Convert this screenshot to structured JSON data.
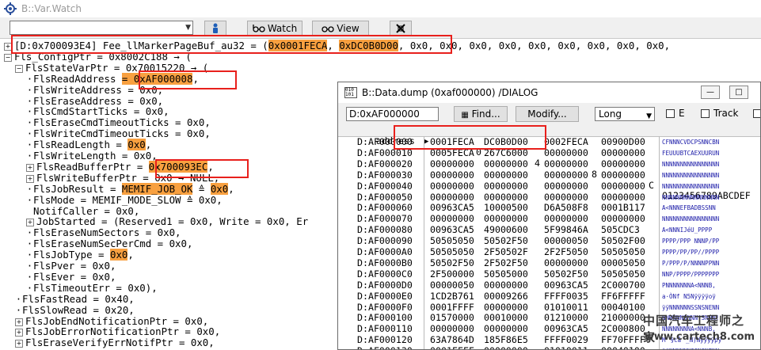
{
  "window": {
    "title": "B::Var.Watch"
  },
  "toolbar": {
    "watch_label": "Watch",
    "view_label": "View"
  },
  "tree": [
    {
      "level": 0,
      "expander": "plus",
      "marker": "none",
      "text": "[D:0x700093E4] Fee_llMarkerPageBuf_au32 = (",
      "hl": "0x0001FECA",
      "sep": ", ",
      "hl2": "0xDC0B0D00",
      "tail": ", 0x0, 0x0, 0x0, 0x0, 0x0, 0x0, 0x0, 0x0, 0x0,"
    },
    {
      "level": 0,
      "expander": "minus",
      "marker": "none",
      "text": "Fls_ConfigPtr = 0x8002C188 → ("
    },
    {
      "level": 1,
      "expander": "minus",
      "marker": "none",
      "text": "FlsStateVarPtr = 0x70015220 → ("
    },
    {
      "level": 2,
      "expander": "none",
      "marker": "dot",
      "text": "FlsReadAddress ",
      "hl": "= 0xAF000008",
      "tail": ","
    },
    {
      "level": 2,
      "expander": "none",
      "marker": "dot",
      "text": "FlsWriteAddress = 0x0,"
    },
    {
      "level": 2,
      "expander": "none",
      "marker": "dot",
      "text": "FlsEraseAddress = 0x0,"
    },
    {
      "level": 2,
      "expander": "none",
      "marker": "dot",
      "text": "FlsCmdStartTicks = 0x0,"
    },
    {
      "level": 2,
      "expander": "none",
      "marker": "dot",
      "text": "FlsEraseCmdTimeoutTicks = 0x0,"
    },
    {
      "level": 2,
      "expander": "none",
      "marker": "dot",
      "text": "FlsWriteCmdTimeoutTicks = 0x0,"
    },
    {
      "level": 2,
      "expander": "none",
      "marker": "dot",
      "text": "FlsReadLength = ",
      "hl": "0x0",
      "tail": ","
    },
    {
      "level": 2,
      "expander": "none",
      "marker": "dot",
      "text": "FlsWriteLength = 0x0,"
    },
    {
      "level": 2,
      "expander": "plus",
      "marker": "none",
      "text": "FlsReadBufferPtr = ",
      "hl": "0x700093EC",
      "tail": ","
    },
    {
      "level": 2,
      "expander": "plus",
      "marker": "none",
      "text": "FlsWriteBufferPtr = 0x0 → NULL,"
    },
    {
      "level": 2,
      "expander": "none",
      "marker": "dot",
      "text": "FlsJobResult = ",
      "hl": "MEMIF_JOB_OK",
      "sep": " ≙ ",
      "hl2": "0x0",
      "tail": ","
    },
    {
      "level": 2,
      "expander": "none",
      "marker": "dot",
      "text": "FlsMode = MEMIF_MODE_SLOW ≙ 0x0,"
    },
    {
      "level": 2,
      "expander": "none",
      "marker": "none",
      "text": "NotifCaller = 0x0,"
    },
    {
      "level": 2,
      "expander": "plus",
      "marker": "none",
      "text": "JobStarted = (Reserved1 = 0x0, Write = 0x0, Er"
    },
    {
      "level": 2,
      "expander": "none",
      "marker": "dot",
      "text": "FlsEraseNumSectors = 0x0,"
    },
    {
      "level": 2,
      "expander": "none",
      "marker": "dot",
      "text": "FlsEraseNumSecPerCmd = 0x0,"
    },
    {
      "level": 2,
      "expander": "none",
      "marker": "dot",
      "text": "FlsJobType = ",
      "hl": "0x0",
      "tail": ","
    },
    {
      "level": 2,
      "expander": "none",
      "marker": "dot",
      "text": "FlsPver = 0x0,"
    },
    {
      "level": 2,
      "expander": "none",
      "marker": "dot",
      "text": "FlsEver = 0x0,"
    },
    {
      "level": 2,
      "expander": "none",
      "marker": "dot",
      "text": "FlsTimeoutErr = 0x0),"
    },
    {
      "level": 1,
      "expander": "none",
      "marker": "dot",
      "text": "FlsFastRead = 0x40,"
    },
    {
      "level": 1,
      "expander": "none",
      "marker": "dot",
      "text": "FlsSlowRead = 0x20,"
    },
    {
      "level": 1,
      "expander": "plus",
      "marker": "none",
      "text": "FlsJobEndNotificationPtr = 0x0,"
    },
    {
      "level": 1,
      "expander": "plus",
      "marker": "none",
      "text": "FlsJobErrorNotificationPtr = 0x0,"
    },
    {
      "level": 1,
      "expander": "plus",
      "marker": "none",
      "text": "FlsEraseVerifyErrNotifPtr = 0x0,"
    }
  ],
  "dump": {
    "title": "B::Data.dump (0xaf000000) /DIALOG",
    "address_value": "D:0xAF000000",
    "find_label": "Find...",
    "modify_label": "Modify...",
    "format_value": "Long",
    "check_e_label": "E",
    "check_track_label": "Track",
    "header": {
      "address": "address",
      "col0": "0",
      "col4": "4",
      "col8": "8",
      "colC": "C",
      "ascii": "0123456789ABCDEF"
    },
    "rows": [
      {
        "addr": "D:AF000000",
        "w0": "0001FECA",
        "w1": "DC0B0D00",
        "w2": "0002FECA",
        "w3": "00900D00",
        "ascii": "CFNNNCVDCPSNNCBN"
      },
      {
        "addr": "D:AF000010",
        "w0": "0005FECA",
        "w1": "267C6000",
        "w2": "00000000",
        "w3": "00000000",
        "ascii": "FEUUUBTCAEXUURUN"
      },
      {
        "addr": "D:AF000020",
        "w0": "00000000",
        "w1": "00000000",
        "w2": "00000000",
        "w3": "00000000",
        "ascii": "NNNNNNNNNNNNNNNN"
      },
      {
        "addr": "D:AF000030",
        "w0": "00000000",
        "w1": "00000000",
        "w2": "00000000",
        "w3": "00000000",
        "ascii": "NNNNNNNNNNNNNNNN"
      },
      {
        "addr": "D:AF000040",
        "w0": "00000000",
        "w1": "00000000",
        "w2": "00000000",
        "w3": "00000000",
        "ascii": "NNNNNNNNNNNNNNNN"
      },
      {
        "addr": "D:AF000050",
        "w0": "00000000",
        "w1": "00000000",
        "w2": "00000000",
        "w3": "00000000",
        "ascii": "NNNNNNNNNNNNNNNN"
      },
      {
        "addr": "D:AF000060",
        "w0": "00963CA5",
        "w1": "10000500",
        "w2": "D6A508F8",
        "w3": "0001B117",
        "ascii": "A<NNNEFBADBSSNN"
      },
      {
        "addr": "D:AF000070",
        "w0": "00000000",
        "w1": "00000000",
        "w2": "00000000",
        "w3": "00000000",
        "ascii": "NNNNNNNNNNNNNNNN"
      },
      {
        "addr": "D:AF000080",
        "w0": "00963CA5",
        "w1": "49000600",
        "w2": "5F99846A",
        "w3": "505CDC3",
        "ascii": "A<NNNIJéU_PPPP"
      },
      {
        "addr": "D:AF000090",
        "w0": "50505050",
        "w1": "50502F50",
        "w2": "00000050",
        "w3": "50502F00",
        "ascii": "PPPP/PPP NNNP/PP"
      },
      {
        "addr": "D:AF0000A0",
        "w0": "50505050",
        "w1": "2F50502F",
        "w2": "2F2F5050",
        "w3": "50505050",
        "ascii": "PPPP/PP/PP//PPPP"
      },
      {
        "addr": "D:AF0000B0",
        "w0": "50502F50",
        "w1": "2F502F50",
        "w2": "00000000",
        "w3": "00005050",
        "ascii": "P/PPP/P/NNNNPPNN"
      },
      {
        "addr": "D:AF0000C0",
        "w0": "2F500000",
        "w1": "50505000",
        "w2": "50502F50",
        "w3": "50505050",
        "ascii": "NNP/PPPP/PPPPPPP"
      },
      {
        "addr": "D:AF0000D0",
        "w0": "00000050",
        "w1": "00000000",
        "w2": "00963CA5",
        "w3": "2C000700",
        "ascii": "PNNNNNNNA<NNNB,"
      },
      {
        "addr": "D:AF0000E0",
        "w0": "1CD2B761",
        "w1": "00009266",
        "w2": "FFFF0035",
        "w3": "FF6FFFFF",
        "ascii": "a·ÒNfN5Nÿÿÿÿoÿ"
      },
      {
        "addr": "D:AF0000F0",
        "w0": "0001FFFF",
        "w1": "00000000",
        "w2": "01010011",
        "w3": "00040100",
        "ascii": "ÿÿNNNNNNSSNSNENN"
      },
      {
        "addr": "D:AF000100",
        "w0": "01570000",
        "w1": "00010000",
        "w2": "01210000",
        "w3": "21000000",
        "ascii": "NNWNNNSNNN!SNNN!"
      },
      {
        "addr": "D:AF000110",
        "w0": "00000000",
        "w1": "00000000",
        "w2": "00963CA5",
        "w3": "2C000800",
        "ascii": "NNNNNNNNA<NNNB,"
      },
      {
        "addr": "D:AF000120",
        "w0": "63A7864D",
        "w1": "185F86E5",
        "w2": "FFFF0029",
        "w3": "FF70FFFF",
        "ascii": "M§cå_N)Nÿÿÿÿpÿ"
      },
      {
        "addr": "D:AF000130",
        "w0": "0001FFFF",
        "w1": "00000000",
        "w2": "01010011",
        "w3": "00040100",
        "ascii": "ÿÿNNNNNNSSNSNENN"
      }
    ]
  },
  "watermark": {
    "line1": "中国汽车工程师之家",
    "line2": "www.cartech8.com"
  },
  "colors": {
    "highlight": "#f8a040",
    "annotation_box": "#e8201c",
    "ascii_text": "#1b1ba8"
  }
}
